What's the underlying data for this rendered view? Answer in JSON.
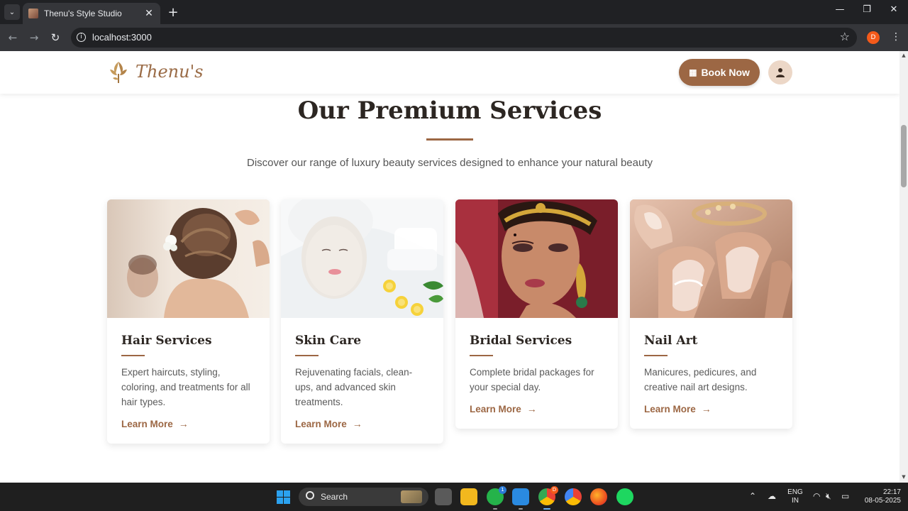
{
  "browser": {
    "tab_title": "Thenu's Style Studio",
    "url": "localhost:3000",
    "profile_initial": "D"
  },
  "header": {
    "logo_text": "Thenu's",
    "book_label": "Book Now"
  },
  "services": {
    "title": "Our Premium Services",
    "subtitle": "Discover our range of luxury beauty services designed to enhance your natural beauty",
    "cards": [
      {
        "title": "Hair Services",
        "desc": "Expert haircuts, styling, coloring, and treatments for all hair types.",
        "link": "Learn More"
      },
      {
        "title": "Skin Care",
        "desc": "Rejuvenating facials, clean-ups, and advanced skin treatments.",
        "link": "Learn More"
      },
      {
        "title": "Bridal Services",
        "desc": "Complete bridal packages for your special day.",
        "link": "Learn More"
      },
      {
        "title": "Nail Art",
        "desc": "Manicures, pedicures, and creative nail art designs.",
        "link": "Learn More"
      }
    ]
  },
  "taskbar": {
    "search_label": "Search",
    "whatsapp_badge": "1",
    "chrome_badge": "D",
    "lang_top": "ENG",
    "lang_bottom": "IN",
    "time": "22:17",
    "date": "08-05-2025"
  },
  "colors": {
    "accent": "#9c6744",
    "heading": "#2c2622",
    "chrome_dark": "#202124"
  }
}
